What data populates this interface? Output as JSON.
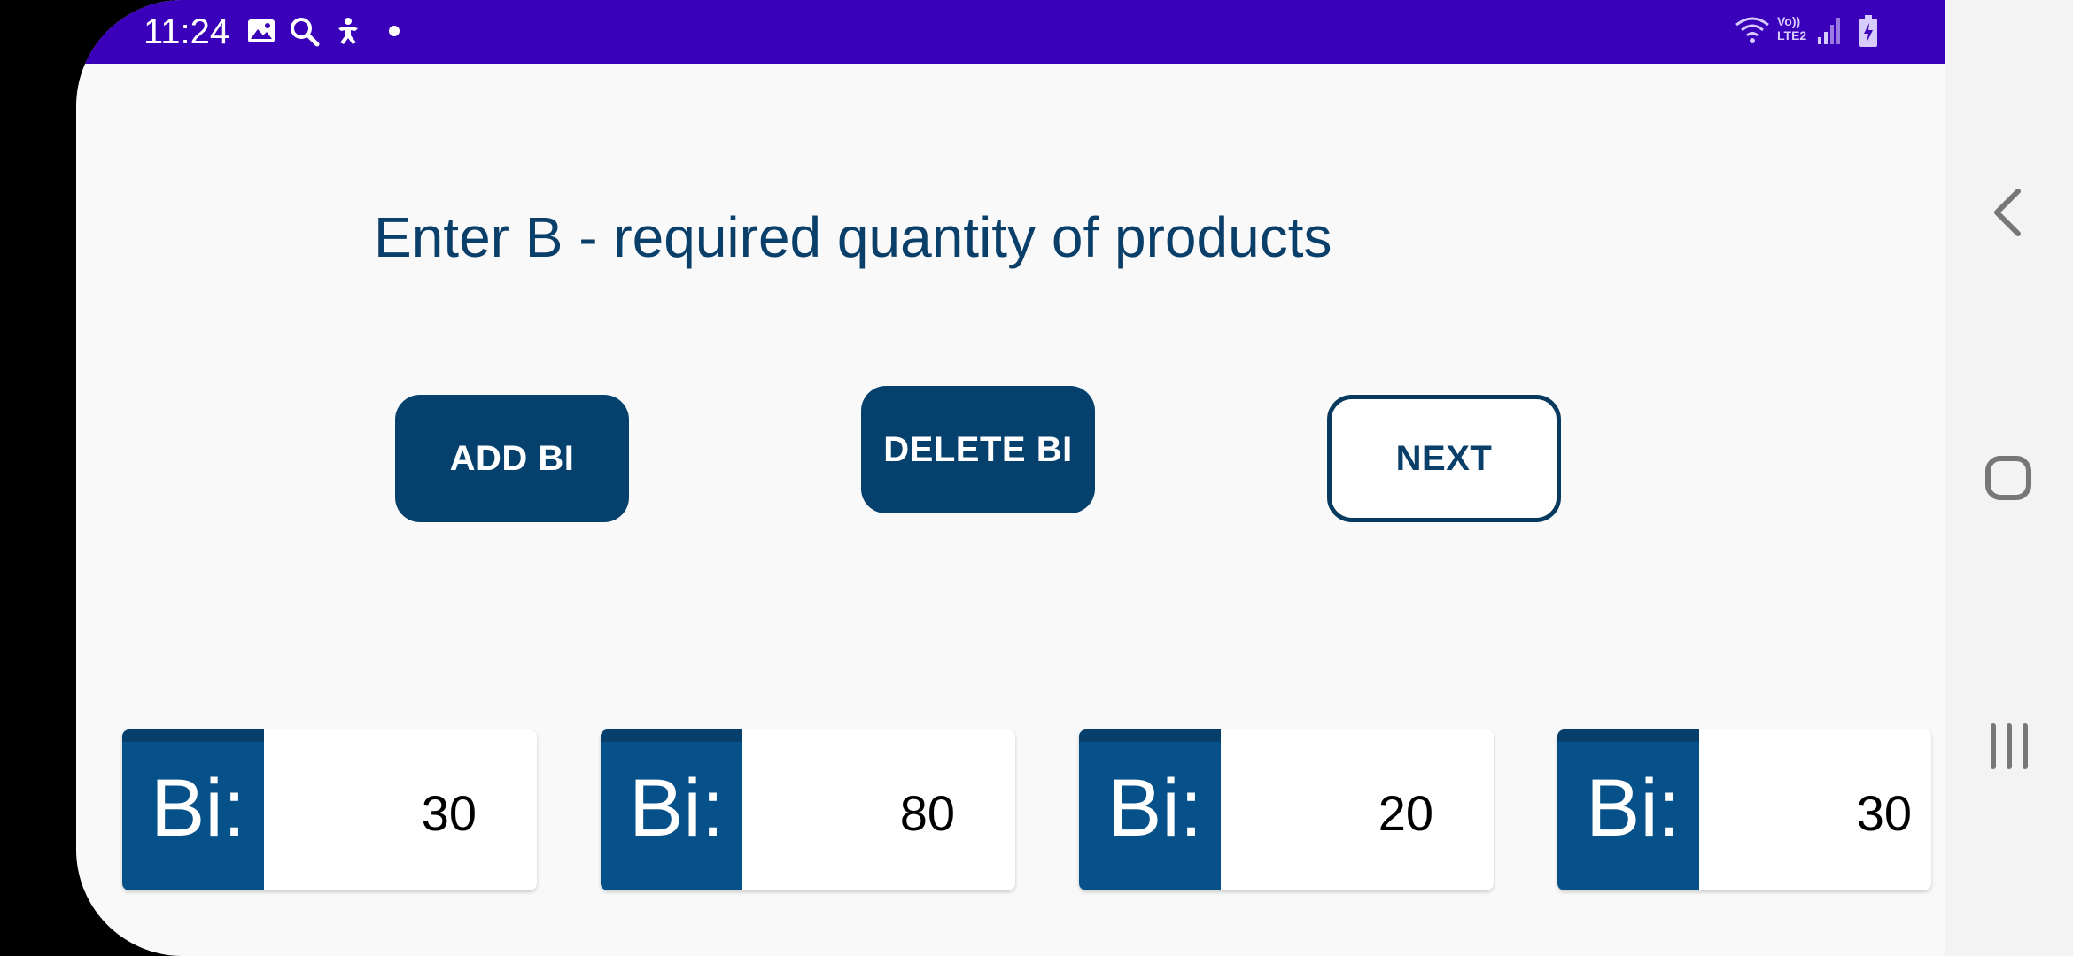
{
  "status_bar": {
    "time": "11:24",
    "left_icons": [
      "image-icon",
      "search-icon",
      "accessibility-icon",
      "dot-icon"
    ],
    "right_icons": [
      "wifi-icon",
      "volte-lte2-icon",
      "signal-icon",
      "battery-charging-icon"
    ],
    "network_label_top": "Vo))",
    "network_label_bottom": "LTE2"
  },
  "main": {
    "title": "Enter B - required quantity of products",
    "buttons": {
      "add": "ADD BI",
      "delete": "DELETE BI",
      "next": "NEXT"
    },
    "items": [
      {
        "label": "Bi:",
        "value": "30"
      },
      {
        "label": "Bi:",
        "value": "80"
      },
      {
        "label": "Bi:",
        "value": "20"
      },
      {
        "label": "Bi:",
        "value": "30"
      }
    ]
  },
  "nav_bar": {
    "icons": [
      "back-icon",
      "home-icon",
      "recents-icon"
    ]
  },
  "colors": {
    "status_bar": "#3b00b9",
    "primary": "#06416e",
    "title_text": "#0a3f6a",
    "background": "#f9f9f9"
  }
}
